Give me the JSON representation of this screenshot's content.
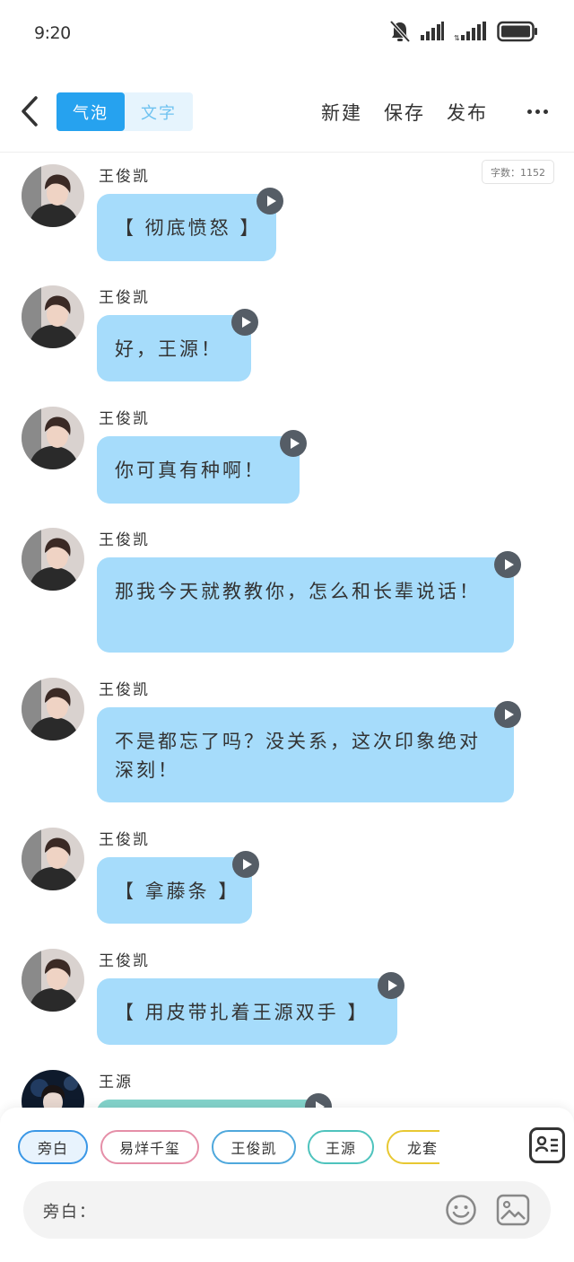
{
  "status": {
    "time": "9:20"
  },
  "header": {
    "tabs": [
      {
        "label": "气泡"
      },
      {
        "label": "文字"
      }
    ],
    "actions": [
      {
        "label": "新建"
      },
      {
        "label": "保存"
      },
      {
        "label": "发布"
      }
    ]
  },
  "word_count": "字数：1152",
  "messages": [
    {
      "sender": "王俊凯",
      "text": "【 彻底愤怒 】"
    },
    {
      "sender": "王俊凯",
      "text": "好，王源！"
    },
    {
      "sender": "王俊凯",
      "text": "你可真有种啊！"
    },
    {
      "sender": "王俊凯",
      "text": "那我今天就教教你，怎么和长辈说话！"
    },
    {
      "sender": "王俊凯",
      "text": "不是都忘了吗？没关系，这次印象绝对深刻！"
    },
    {
      "sender": "王俊凯",
      "text": "【 拿藤条 】"
    },
    {
      "sender": "王俊凯",
      "text": "【 用皮带扎着王源双手 】"
    },
    {
      "sender": "王源",
      "text": ""
    }
  ],
  "characters": [
    {
      "label": "旁白",
      "color": "#3a97e6"
    },
    {
      "label": "易烊千玺",
      "color": "#e58fa8"
    },
    {
      "label": "王俊凯",
      "color": "#4fa8dc"
    },
    {
      "label": "王源",
      "color": "#4ec3bd"
    },
    {
      "label": "龙套",
      "color": "#e8c832"
    }
  ],
  "input": {
    "label": "旁白："
  },
  "colors": {
    "accent": "#26a2ef",
    "bubble": "#a6dcfb",
    "bubble_alt": "#83d3cb"
  },
  "icons": [
    "back-arrow-icon",
    "more-icon",
    "play-icon",
    "role-card-icon",
    "emoji-icon",
    "image-icon",
    "mute-bell-icon",
    "signal-icon",
    "battery-icon"
  ]
}
